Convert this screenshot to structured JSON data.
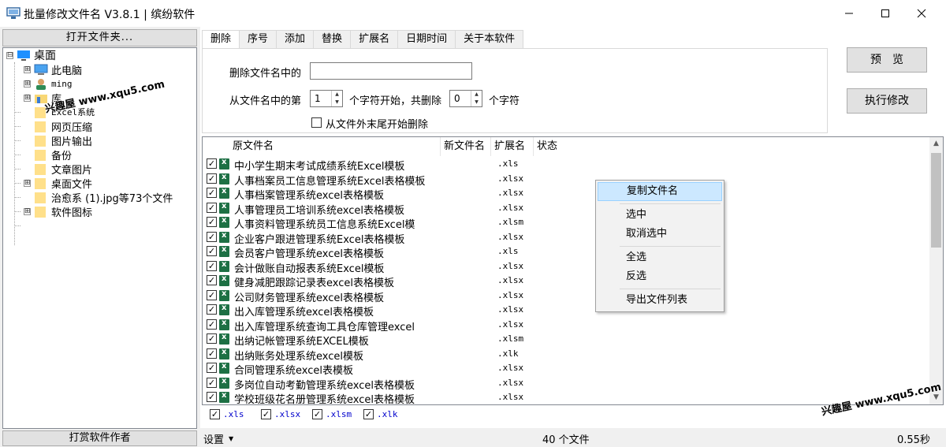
{
  "window": {
    "title": "批量修改文件名 V3.8.1 | 缤纷软件"
  },
  "left_panel": {
    "open_folder_label": "打开文件夹...",
    "donate_label": "打赏软件作者",
    "tree": [
      {
        "label": "桌面",
        "level": 0,
        "expander": "⊟",
        "icon": "desktop-icon"
      },
      {
        "label": "此电脑",
        "level": 1,
        "expander": "⊞",
        "icon": "computer-icon"
      },
      {
        "label": "ming",
        "level": 1,
        "expander": "⊞",
        "icon": "user-icon"
      },
      {
        "label": "库",
        "level": 1,
        "expander": "⊞",
        "icon": "library-icon"
      },
      {
        "label": "Excel系统",
        "level": 1,
        "expander": "",
        "icon": "folder-icon"
      },
      {
        "label": "网页压缩",
        "level": 1,
        "expander": "",
        "icon": "folder-icon"
      },
      {
        "label": "图片输出",
        "level": 1,
        "expander": "",
        "icon": "folder-icon"
      },
      {
        "label": "备份",
        "level": 1,
        "expander": "",
        "icon": "folder-icon"
      },
      {
        "label": "文章图片",
        "level": 1,
        "expander": "",
        "icon": "folder-icon"
      },
      {
        "label": "桌面文件",
        "level": 1,
        "expander": "⊞",
        "icon": "folder-icon"
      },
      {
        "label": "治愈系 (1).jpg等73个文件",
        "level": 1,
        "expander": "",
        "icon": "folder-icon"
      },
      {
        "label": "软件图标",
        "level": 1,
        "expander": "⊞",
        "icon": "folder-icon"
      }
    ]
  },
  "tabs": [
    "删除",
    "序号",
    "添加",
    "替换",
    "扩展名",
    "日期时间",
    "关于本软件"
  ],
  "delete_panel": {
    "delete_in_name_label": "删除文件名中的",
    "delete_in_name_value": "",
    "from_position_label": "从文件名中的第",
    "start_value": "1",
    "start_suffix_label": "个字符开始，共删除",
    "count_value": "0",
    "count_suffix_label": "个字符",
    "from_end_label": "从文件外末尾开始删除"
  },
  "buttons": {
    "preview": "预　览",
    "execute": "执行修改"
  },
  "file_list": {
    "columns": [
      "原文件名",
      "新文件名",
      "扩展名",
      "状态"
    ],
    "rows": [
      {
        "name": "中小学生期末考试成绩系统Excel模板",
        "ext": ".xls"
      },
      {
        "name": "人事档案员工信息管理系统Excel表格模板",
        "ext": ".xlsx"
      },
      {
        "name": "人事档案管理系统excel表格模板",
        "ext": ".xlsx"
      },
      {
        "name": "人事管理员工培训系统excel表格模板",
        "ext": ".xlsx"
      },
      {
        "name": "人事资料管理系统员工信息系统Excel模",
        "ext": ".xlsm"
      },
      {
        "name": "企业客户跟进管理系统Excel表格模板",
        "ext": ".xlsx"
      },
      {
        "name": "会员客户管理系统excel表格模板",
        "ext": ".xls"
      },
      {
        "name": "会计做账自动报表系统Excel模板",
        "ext": ".xlsx"
      },
      {
        "name": "健身减肥跟踪记录表excel表格模板",
        "ext": ".xlsx"
      },
      {
        "name": "公司财务管理系统excel表格模板",
        "ext": ".xlsx"
      },
      {
        "name": "出入库管理系统excel表格模板",
        "ext": ".xlsx"
      },
      {
        "name": "出入库管理系统查询工具仓库管理excel",
        "ext": ".xlsx"
      },
      {
        "name": "出纳记帐管理系统EXCEL模板",
        "ext": ".xlsm"
      },
      {
        "name": "出纳账务处理系统excel模板",
        "ext": ".xlk"
      },
      {
        "name": "合同管理系统excel表模板",
        "ext": ".xlsx"
      },
      {
        "name": "多岗位自动考勤管理系统excel表格模板",
        "ext": ".xlsx"
      },
      {
        "name": "学校班级花名册管理系统excel表格模板",
        "ext": ".xlsx"
      }
    ]
  },
  "context_menu": {
    "items": [
      "复制文件名",
      "选中",
      "取消选中",
      "全选",
      "反选",
      "导出文件列表"
    ]
  },
  "filters": [
    ".xls",
    ".xlsx",
    ".xlsm",
    ".xlk"
  ],
  "status_bar": {
    "settings_label": "设置",
    "file_count": "40 个文件",
    "elapsed": "0.55秒"
  },
  "watermarks": {
    "left": "兴趣屋 www.xqu5.com",
    "right": "兴趣屋 www.xqu5.com"
  }
}
